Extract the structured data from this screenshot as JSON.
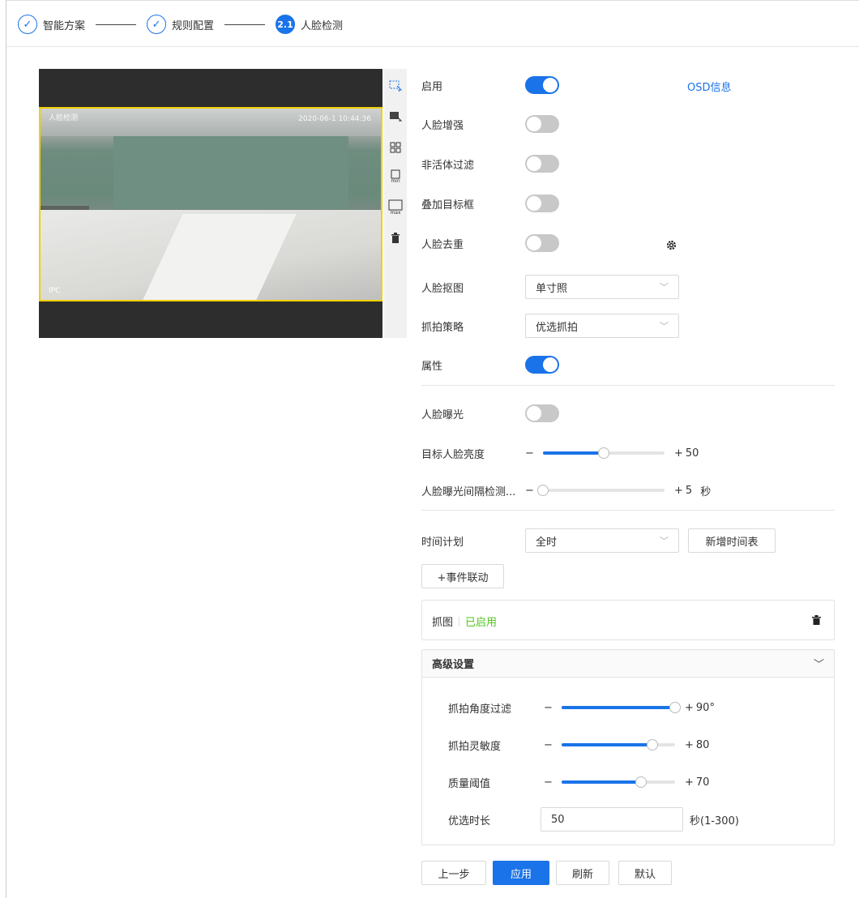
{
  "stepper": {
    "steps": [
      {
        "label": "智能方案",
        "marker": "✓"
      },
      {
        "label": "规则配置",
        "marker": "✓"
      },
      {
        "label": "人脸检测",
        "marker": "2.1"
      }
    ]
  },
  "video": {
    "osd_left": "人脸检测",
    "osd_time": "2020-06-1 10:44:36",
    "osd_bottom": "IPC"
  },
  "toolbar": {
    "icons": [
      "draw-region-icon",
      "draw-exclude-icon",
      "qr-target-icon",
      "min-size-icon",
      "max-size-icon",
      "trash-icon"
    ],
    "min_label": "min",
    "max_label": "max"
  },
  "form": {
    "enable_label": "启用",
    "enable_on": true,
    "osd_link": "OSD信息",
    "face_enhance_label": "人脸增强",
    "anti_spoof_label": "非活体过滤",
    "overlay_box_label": "叠加目标框",
    "dedupe_label": "人脸去重",
    "face_crop_label": "人脸抠图",
    "face_crop_value": "单寸照",
    "snap_strategy_label": "抓拍策略",
    "snap_strategy_value": "优选抓拍",
    "attributes_label": "属性",
    "attributes_on": true,
    "face_exposure_label": "人脸曝光",
    "brightness_label": "目标人脸亮度",
    "brightness_value": "50",
    "brightness_fraction": 0.5,
    "interval_label": "人脸曝光间隔检测...",
    "interval_value": "5",
    "interval_unit": "秒",
    "interval_fraction": 0.0,
    "schedule_label": "时间计划",
    "schedule_value": "全时",
    "add_schedule_button": "新增时间表",
    "event_link_button": "+事件联动",
    "snap_card_label": "抓图",
    "snap_card_status": "已启用",
    "advanced_title": "高级设置",
    "angle_label": "抓拍角度过滤",
    "angle_value": "90°",
    "angle_fraction": 1.0,
    "sensitivity_label": "抓拍灵敏度",
    "sensitivity_value": "80",
    "sensitivity_fraction": 0.8,
    "quality_label": "质量阈值",
    "quality_value": "70",
    "quality_fraction": 0.7,
    "optimal_label": "优选时长",
    "optimal_value": "50",
    "optimal_hint": "秒(1-300)"
  },
  "actions": {
    "prev": "上一步",
    "apply": "应用",
    "refresh": "刷新",
    "default": "默认"
  },
  "colors": {
    "accent": "#1a73e8",
    "enabled_text": "#52c41a",
    "rule_box": "#f0d000"
  }
}
